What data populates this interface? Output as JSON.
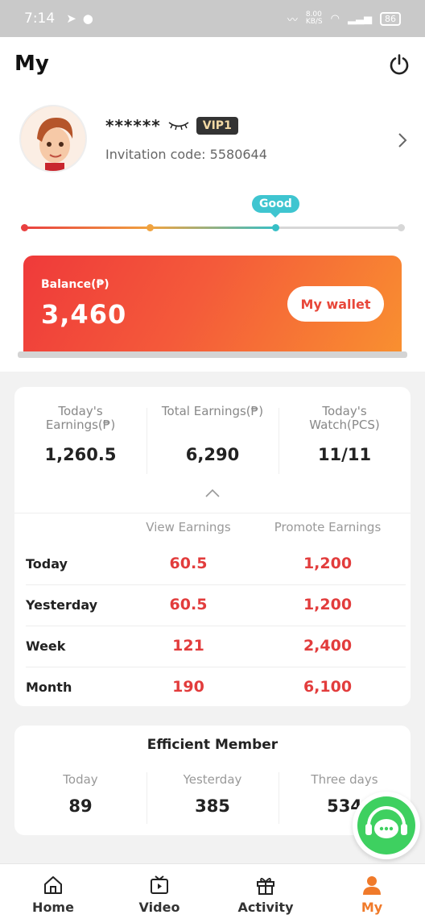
{
  "status_bar": {
    "time": "7:14",
    "network_speed": "8.00\nKB/S",
    "battery": "86"
  },
  "header": {
    "title": "My"
  },
  "profile": {
    "masked_name": "******",
    "vip": "VIP1",
    "invitation_code": "Invitation code: 5580644"
  },
  "level": {
    "label": "Good",
    "progress_fraction": 0.67,
    "step_colors": [
      "#e94040",
      "#f0a340",
      "#37bfc6",
      "#d7d7d7"
    ]
  },
  "balance": {
    "label": "Balance(₱)",
    "value": "3,460",
    "wallet_button": "My wallet"
  },
  "stats": {
    "todays_earnings_label": "Today's Earnings(₱)",
    "todays_earnings": "1,260.5",
    "total_earnings_label": "Total Earnings(₱)",
    "total_earnings": "6,290",
    "todays_watch_label": "Today's Watch(PCS)",
    "todays_watch": "11/11",
    "view_earnings_label": "View Earnings",
    "promote_earnings_label": "Promote Earnings",
    "rows": [
      {
        "label": "Today",
        "view": "60.5",
        "promote": "1,200"
      },
      {
        "label": "Yesterday",
        "view": "60.5",
        "promote": "1,200"
      },
      {
        "label": "Week",
        "view": "121",
        "promote": "2,400"
      },
      {
        "label": "Month",
        "view": "190",
        "promote": "6,100"
      }
    ]
  },
  "members": {
    "title": "Efficient Member",
    "today_label": "Today",
    "today": "89",
    "yesterday_label": "Yesterday",
    "yesterday": "385",
    "three_days_label": "Three days",
    "three_days": "534"
  },
  "nav": {
    "home": "Home",
    "video": "Video",
    "activity": "Activity",
    "my": "My"
  },
  "colors": {
    "accent": "#f07a2a",
    "earning_red": "#e23c3c",
    "chat_green": "#3ed060"
  }
}
